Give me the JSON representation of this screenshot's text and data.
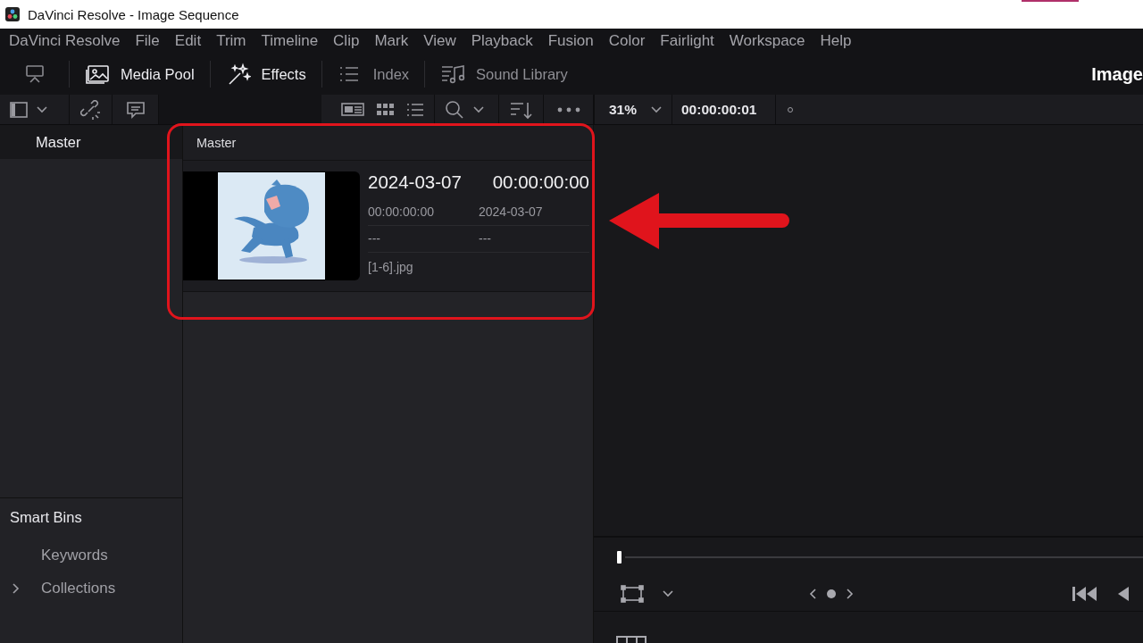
{
  "window": {
    "title": "DaVinci Resolve - Image Sequence"
  },
  "menu": [
    "DaVinci Resolve",
    "File",
    "Edit",
    "Trim",
    "Timeline",
    "Clip",
    "Mark",
    "View",
    "Playback",
    "Fusion",
    "Color",
    "Fairlight",
    "Workspace",
    "Help"
  ],
  "modules": [
    {
      "label": "Media Pool",
      "active": true
    },
    {
      "label": "Effects",
      "active": true
    },
    {
      "label": "Index",
      "active": false
    },
    {
      "label": "Sound Library",
      "active": false
    }
  ],
  "viewer_title": "Image",
  "bins": [
    {
      "label": "Master",
      "selected": true
    }
  ],
  "smart_bins": {
    "title": "Smart Bins",
    "items": [
      {
        "label": "Keywords",
        "expandable": false
      },
      {
        "label": "Collections",
        "expandable": true
      }
    ]
  },
  "media_pool": {
    "bin_title": "Master",
    "clips": [
      {
        "kind": "picture",
        "date": "2024-03-07",
        "timecode": "00:00:00:00",
        "fields": [
          "00:00:00:00",
          "2024-03-07",
          "---",
          "---",
          "[1-6].jpg"
        ]
      }
    ]
  },
  "viewer": {
    "zoom": "31%",
    "timecode": "00:00:00:01"
  }
}
